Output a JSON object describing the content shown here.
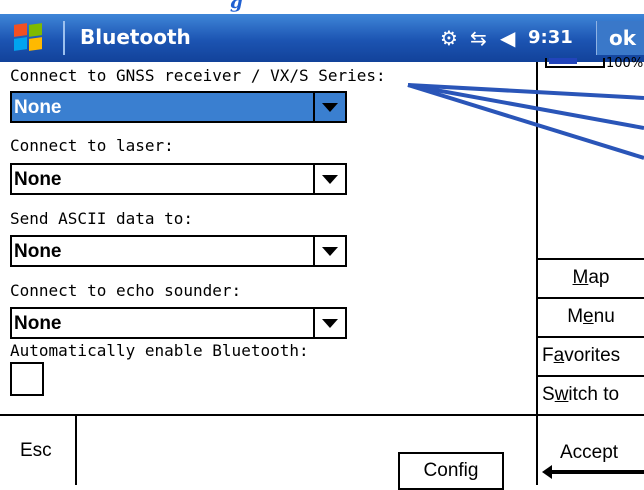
{
  "top_strip": {
    "text": "g"
  },
  "titlebar": {
    "title": "Bluetooth",
    "clock": "9:31",
    "ok_label": "ok",
    "icons": [
      "start-menu-windows-logo",
      "network-sync-icon",
      "connectivity-arrows-icon",
      "speaker-volume-icon"
    ]
  },
  "form": {
    "gnss": {
      "label": "Connect to GNSS receiver / VX/S Series:",
      "value": "None"
    },
    "laser": {
      "label": "Connect to laser:",
      "value": "None"
    },
    "ascii": {
      "label": "Send ASCII data to:",
      "value": "None"
    },
    "echo": {
      "label": "Connect to echo sounder:",
      "value": "None"
    },
    "auto_enable": {
      "label": "Automatically enable Bluetooth:",
      "checked": false
    }
  },
  "side_panel": {
    "battery_text": "100%",
    "battery_level": 0.5,
    "buttons": [
      {
        "pre": "",
        "key": "M",
        "post": "ap"
      },
      {
        "pre": "M",
        "key": "e",
        "post": "nu"
      },
      {
        "pre": "F",
        "key": "a",
        "post": "vorites"
      },
      {
        "pre": "S",
        "key": "w",
        "post": "itch to"
      }
    ]
  },
  "bottom_bar": {
    "esc_label": "Esc",
    "config_label": "Config",
    "accept_label": "Accept"
  },
  "colors": {
    "titlebar": "#1c54b2",
    "selected_dropdown": "#3a7fd0",
    "callout_lines": "#2a55b8"
  }
}
